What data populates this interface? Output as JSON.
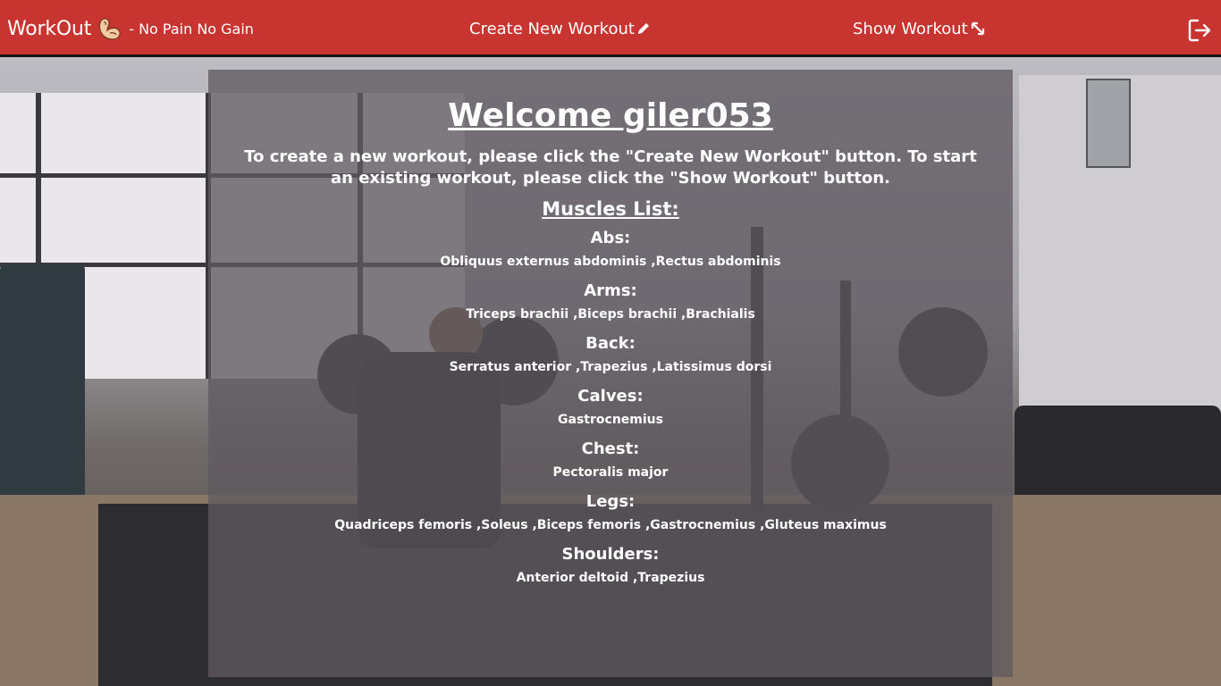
{
  "nav": {
    "brand_title": "WorkOut",
    "brand_subtitle": "- No Pain No Gain",
    "brand_icon": "flexed-arm-icon",
    "create_label": "Create New Workout",
    "create_icon": "pencil-icon",
    "show_label": "Show Workout",
    "show_icon": "expand-arrows-icon",
    "logout_icon": "logout-icon"
  },
  "main": {
    "welcome": "Welcome giler053",
    "intro": "To create a new workout, please click the \"Create New Workout\" button. To start an existing workout, please click the \"Show Workout\" button.",
    "muscles_title": "Muscles List:",
    "groups": [
      {
        "name": "Abs:",
        "muscles": "Obliquus externus abdominis ,Rectus abdominis"
      },
      {
        "name": "Arms:",
        "muscles": "Triceps brachii ,Biceps brachii ,Brachialis"
      },
      {
        "name": "Back:",
        "muscles": "Serratus anterior ,Trapezius ,Latissimus dorsi"
      },
      {
        "name": "Calves:",
        "muscles": "Gastrocnemius"
      },
      {
        "name": "Chest:",
        "muscles": "Pectoralis major"
      },
      {
        "name": "Legs:",
        "muscles": "Quadriceps femoris ,Soleus ,Biceps femoris ,Gastrocnemius ,Gluteus maximus"
      },
      {
        "name": "Shoulders:",
        "muscles": "Anterior deltoid ,Trapezius"
      }
    ]
  },
  "colors": {
    "navbar": "#c83430",
    "navbar_border": "#151515",
    "panel": "rgba(95, 90, 96, 0.78)",
    "text": "#ffffff"
  }
}
